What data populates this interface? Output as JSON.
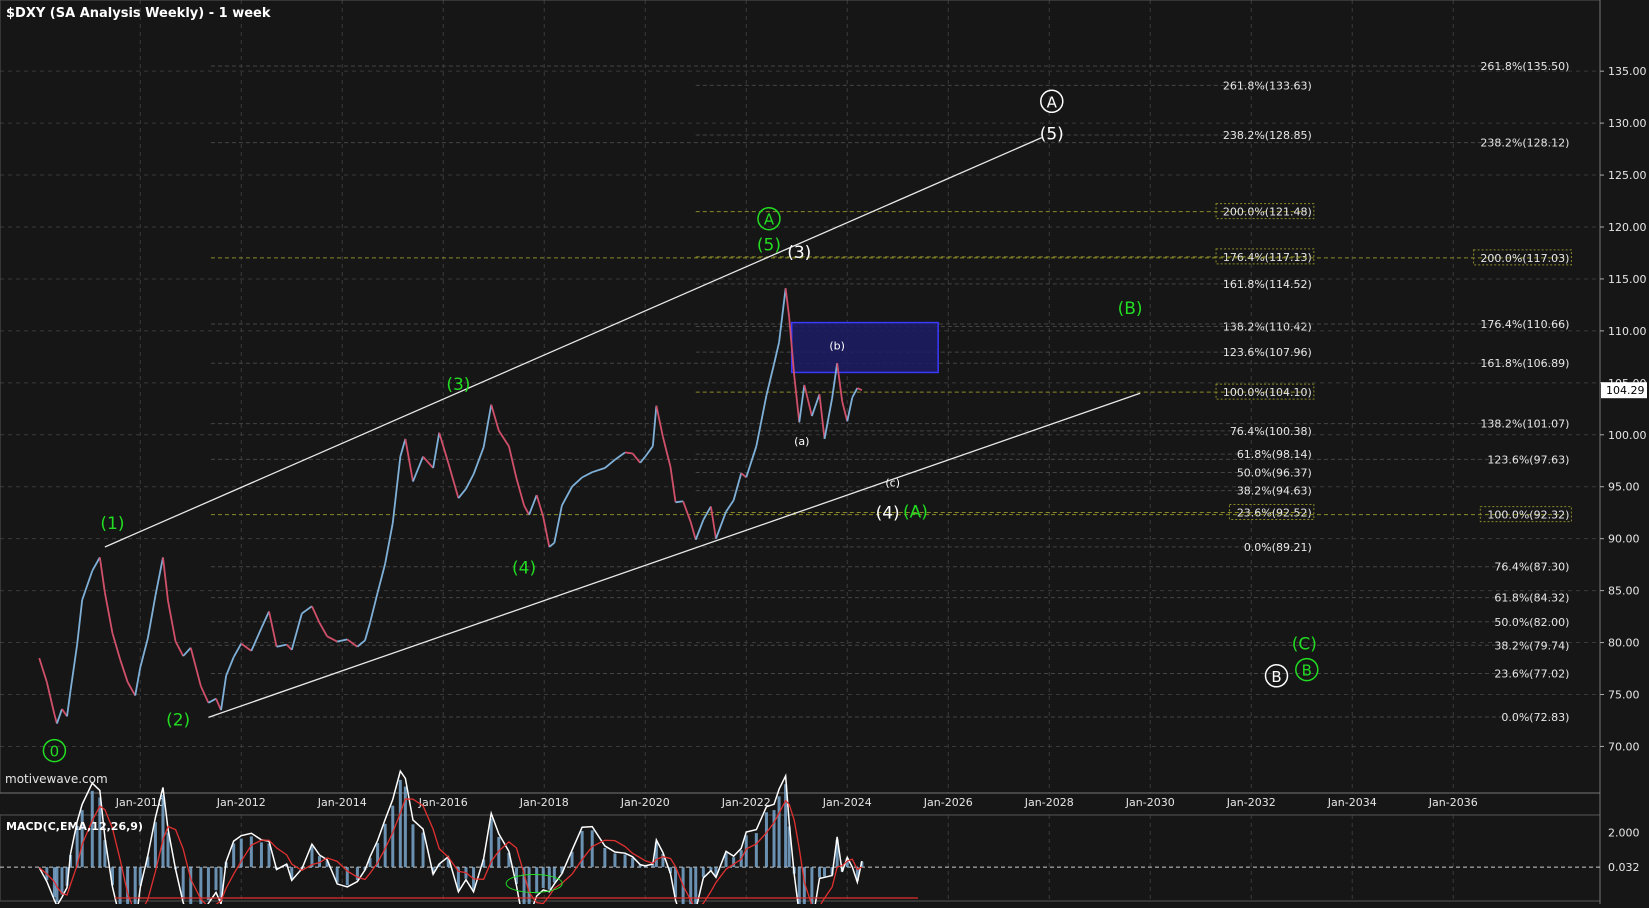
{
  "title": "$DXY (SA Analysis Weekly) - 1 week",
  "watermark": "motivewave.com",
  "colors": {
    "background": "#161616",
    "grid": "#3a3a3a",
    "text": "#e6e6e6",
    "green": "#22dd22",
    "white": "#ffffff",
    "yellow_dash": "#8a8a2a",
    "box_fill": "#1c1c66",
    "box_stroke": "#3a3aff",
    "price_up": "#7fb0d8",
    "price_down": "#d0506a",
    "macd_line": "#ffffff",
    "macd_signal": "#e03030",
    "macd_hist": "#7fb0d8"
  },
  "chart_data": {
    "type": "line",
    "symbol": "$DXY",
    "ylim": [
      66,
      138
    ],
    "xlim": [
      2008.0,
      2038.4
    ],
    "y_ticks": [
      70,
      75,
      80,
      85,
      90,
      95,
      100,
      105,
      110,
      115,
      120,
      125,
      130,
      135
    ],
    "y_tick_labels": [
      "70.00",
      "75.00",
      "80.00",
      "85.00",
      "90.00",
      "95.00",
      "100.00",
      "105.00",
      "110.00",
      "115.00",
      "120.00",
      "125.00",
      "130.00",
      "135.00"
    ],
    "x_ticks": [
      2010,
      2012,
      2014,
      2016,
      2018,
      2020,
      2022,
      2024,
      2026,
      2028,
      2030,
      2032,
      2034,
      2036
    ],
    "x_tick_labels": [
      "Jan-2010",
      "Jan-2012",
      "Jan-2014",
      "Jan-2016",
      "Jan-2018",
      "Jan-2020",
      "Jan-2022",
      "Jan-2024",
      "Jan-2026",
      "Jan-2028",
      "Jan-2030",
      "Jan-2032",
      "Jan-2034",
      "Jan-2036"
    ],
    "last_price": 104.29,
    "last_price_label": "104.29",
    "price_series": [
      [
        2008.0,
        78.5
      ],
      [
        2008.15,
        76.2
      ],
      [
        2008.3,
        73.1
      ],
      [
        2008.35,
        72.2
      ],
      [
        2008.45,
        73.6
      ],
      [
        2008.55,
        72.9
      ],
      [
        2008.62,
        75.4
      ],
      [
        2008.75,
        79.8
      ],
      [
        2008.85,
        84.1
      ],
      [
        2009.05,
        86.9
      ],
      [
        2009.2,
        88.2
      ],
      [
        2009.3,
        84.8
      ],
      [
        2009.45,
        80.9
      ],
      [
        2009.6,
        78.4
      ],
      [
        2009.75,
        76.2
      ],
      [
        2009.9,
        74.9
      ],
      [
        2010.0,
        77.6
      ],
      [
        2010.15,
        80.4
      ],
      [
        2010.3,
        84.5
      ],
      [
        2010.45,
        88.2
      ],
      [
        2010.55,
        84.0
      ],
      [
        2010.7,
        80.1
      ],
      [
        2010.85,
        78.7
      ],
      [
        2011.0,
        79.5
      ],
      [
        2011.2,
        75.8
      ],
      [
        2011.35,
        74.2
      ],
      [
        2011.5,
        74.6
      ],
      [
        2011.6,
        73.5
      ],
      [
        2011.7,
        76.8
      ],
      [
        2011.85,
        78.6
      ],
      [
        2012.0,
        79.9
      ],
      [
        2012.2,
        79.2
      ],
      [
        2012.4,
        81.4
      ],
      [
        2012.55,
        83.0
      ],
      [
        2012.7,
        79.6
      ],
      [
        2012.9,
        79.8
      ],
      [
        2013.0,
        79.3
      ],
      [
        2013.2,
        82.8
      ],
      [
        2013.4,
        83.5
      ],
      [
        2013.55,
        81.9
      ],
      [
        2013.7,
        80.6
      ],
      [
        2013.9,
        80.1
      ],
      [
        2014.1,
        80.3
      ],
      [
        2014.3,
        79.6
      ],
      [
        2014.45,
        80.2
      ],
      [
        2014.55,
        81.9
      ],
      [
        2014.7,
        84.8
      ],
      [
        2014.85,
        87.6
      ],
      [
        2015.0,
        91.5
      ],
      [
        2015.15,
        97.9
      ],
      [
        2015.25,
        99.6
      ],
      [
        2015.4,
        95.5
      ],
      [
        2015.6,
        97.9
      ],
      [
        2015.8,
        96.8
      ],
      [
        2015.92,
        100.2
      ],
      [
        2016.1,
        97.3
      ],
      [
        2016.3,
        93.9
      ],
      [
        2016.45,
        94.8
      ],
      [
        2016.6,
        96.2
      ],
      [
        2016.8,
        98.8
      ],
      [
        2016.95,
        102.9
      ],
      [
        2017.1,
        100.4
      ],
      [
        2017.3,
        98.9
      ],
      [
        2017.45,
        95.8
      ],
      [
        2017.6,
        93.2
      ],
      [
        2017.7,
        92.3
      ],
      [
        2017.85,
        94.2
      ],
      [
        2017.98,
        92.1
      ],
      [
        2018.1,
        89.2
      ],
      [
        2018.2,
        89.6
      ],
      [
        2018.35,
        93.2
      ],
      [
        2018.55,
        95.0
      ],
      [
        2018.75,
        95.9
      ],
      [
        2018.95,
        96.4
      ],
      [
        2019.2,
        96.8
      ],
      [
        2019.4,
        97.6
      ],
      [
        2019.6,
        98.3
      ],
      [
        2019.75,
        98.2
      ],
      [
        2019.9,
        97.3
      ],
      [
        2020.0,
        97.9
      ],
      [
        2020.15,
        98.9
      ],
      [
        2020.22,
        102.8
      ],
      [
        2020.35,
        99.8
      ],
      [
        2020.5,
        96.9
      ],
      [
        2020.6,
        93.5
      ],
      [
        2020.75,
        93.6
      ],
      [
        2020.9,
        91.6
      ],
      [
        2021.0,
        89.9
      ],
      [
        2021.15,
        91.8
      ],
      [
        2021.3,
        93.1
      ],
      [
        2021.4,
        90.0
      ],
      [
        2021.6,
        92.6
      ],
      [
        2021.75,
        93.7
      ],
      [
        2021.9,
        96.3
      ],
      [
        2022.0,
        95.9
      ],
      [
        2022.2,
        98.9
      ],
      [
        2022.4,
        103.8
      ],
      [
        2022.55,
        106.8
      ],
      [
        2022.65,
        108.9
      ],
      [
        2022.78,
        114.1
      ],
      [
        2022.85,
        111.3
      ],
      [
        2022.95,
        105.7
      ],
      [
        2023.05,
        101.2
      ],
      [
        2023.15,
        104.8
      ],
      [
        2023.3,
        101.8
      ],
      [
        2023.45,
        103.9
      ],
      [
        2023.55,
        99.6
      ],
      [
        2023.7,
        103.5
      ],
      [
        2023.8,
        106.9
      ],
      [
        2023.9,
        103.2
      ],
      [
        2024.0,
        101.3
      ],
      [
        2024.1,
        103.6
      ],
      [
        2024.2,
        104.5
      ],
      [
        2024.29,
        104.29
      ]
    ],
    "fib_sets": [
      {
        "name": "inner",
        "line_start_year": 2021.0,
        "label_year": 2033.2,
        "levels": [
          {
            "label": "261.8%(133.63)",
            "value": 133.63
          },
          {
            "label": "238.2%(128.85)",
            "value": 128.85
          },
          {
            "label": "200.0%(121.48)",
            "value": 121.48
          },
          {
            "label": "176.4%(117.13)",
            "value": 117.13
          },
          {
            "label": "161.8%(114.52)",
            "value": 114.52
          },
          {
            "label": "138.2%(110.42)",
            "value": 110.42
          },
          {
            "label": "123.6%(107.96)",
            "value": 107.96
          },
          {
            "label": "100.0%(104.10)",
            "value": 104.1
          },
          {
            "label": "76.4%(100.38)",
            "value": 100.38
          },
          {
            "label": "61.8%(98.14)",
            "value": 98.14
          },
          {
            "label": "50.0%(96.37)",
            "value": 96.37
          },
          {
            "label": "38.2%(94.63)",
            "value": 94.63
          },
          {
            "label": "23.6%(92.52)",
            "value": 92.52
          },
          {
            "label": "0.0%(89.21)",
            "value": 89.21
          }
        ]
      },
      {
        "name": "outer",
        "line_start_year": 2011.4,
        "label_year": 2038.3,
        "levels": [
          {
            "label": "261.8%(135.50)",
            "value": 135.5
          },
          {
            "label": "238.2%(128.12)",
            "value": 128.12
          },
          {
            "label": "200.0%(117.03)",
            "value": 117.03
          },
          {
            "label": "176.4%(110.66)",
            "value": 110.66
          },
          {
            "label": "161.8%(106.89)",
            "value": 106.89
          },
          {
            "label": "138.2%(101.07)",
            "value": 101.07
          },
          {
            "label": "123.6%(97.63)",
            "value": 97.63
          },
          {
            "label": "100.0%(92.32)",
            "value": 92.32
          },
          {
            "label": "76.4%(87.30)",
            "value": 87.3
          },
          {
            "label": "61.8%(84.32)",
            "value": 84.32
          },
          {
            "label": "50.0%(82.00)",
            "value": 82.0
          },
          {
            "label": "38.2%(79.74)",
            "value": 79.74
          },
          {
            "label": "23.6%(77.02)",
            "value": 77.02
          },
          {
            "label": "0.0%(72.83)",
            "value": 72.83
          }
        ]
      }
    ],
    "highlighted_levels": [
      "200.0%(121.48)",
      "176.4%(117.13)",
      "100.0%(104.10)",
      "23.6%(92.52)",
      "200.0%(117.03)",
      "100.0%(92.32)"
    ],
    "channel": {
      "upper": [
        [
          2009.3,
          89.2
        ],
        [
          2027.85,
          128.6
        ]
      ],
      "lower": [
        [
          2011.35,
          72.8
        ],
        [
          2029.8,
          104.0
        ]
      ]
    },
    "target_box": {
      "x0": 2022.9,
      "x1": 2025.8,
      "y0": 106.0,
      "y1": 110.8
    },
    "wave_labels": [
      {
        "text": "0",
        "x": 2008.3,
        "y": 69.6,
        "color": "green",
        "circled": true
      },
      {
        "text": "(1)",
        "x": 2009.45,
        "y": 91.5,
        "color": "green",
        "circled": false
      },
      {
        "text": "(2)",
        "x": 2010.75,
        "y": 72.6,
        "color": "green",
        "circled": false
      },
      {
        "text": "(3)",
        "x": 2016.3,
        "y": 104.9,
        "color": "green",
        "circled": false
      },
      {
        "text": "(4)",
        "x": 2017.6,
        "y": 87.2,
        "color": "green",
        "circled": false
      },
      {
        "text": "A",
        "x": 2022.45,
        "y": 120.8,
        "color": "green",
        "circled": true
      },
      {
        "text": "(5)",
        "x": 2022.45,
        "y": 118.3,
        "color": "green",
        "circled": false
      },
      {
        "text": "(3)",
        "x": 2023.05,
        "y": 117.6,
        "color": "white",
        "circled": false
      },
      {
        "text": "(b)",
        "x": 2023.8,
        "y": 108.6,
        "color": "white",
        "circled": false,
        "small": true
      },
      {
        "text": "(a)",
        "x": 2023.1,
        "y": 99.4,
        "color": "white",
        "circled": false,
        "small": true
      },
      {
        "text": "(c)",
        "x": 2024.9,
        "y": 95.4,
        "color": "white",
        "circled": false,
        "small": true
      },
      {
        "text": "(4)",
        "x": 2024.8,
        "y": 92.5,
        "color": "white",
        "circled": false
      },
      {
        "text": "(A)",
        "x": 2025.35,
        "y": 92.6,
        "color": "green",
        "circled": false
      },
      {
        "text": "(B)",
        "x": 2029.6,
        "y": 112.2,
        "color": "green",
        "circled": false
      },
      {
        "text": "A",
        "x": 2028.05,
        "y": 132.1,
        "color": "white",
        "circled": true
      },
      {
        "text": "(5)",
        "x": 2028.05,
        "y": 129.0,
        "color": "white",
        "circled": false
      },
      {
        "text": "(C)",
        "x": 2033.05,
        "y": 79.9,
        "color": "green",
        "circled": false
      },
      {
        "text": "B",
        "x": 2033.1,
        "y": 77.4,
        "color": "green",
        "circled": true
      },
      {
        "text": "B",
        "x": 2032.5,
        "y": 76.8,
        "color": "white",
        "circled": true
      }
    ],
    "macd": {
      "label": "MACD(C,EMA,12,26,9)",
      "ylim": [
        -1.9,
        3.0
      ],
      "tick_labels": [
        "2.000",
        "0.032"
      ],
      "tick_values": [
        2.0,
        0.032
      ]
    }
  }
}
